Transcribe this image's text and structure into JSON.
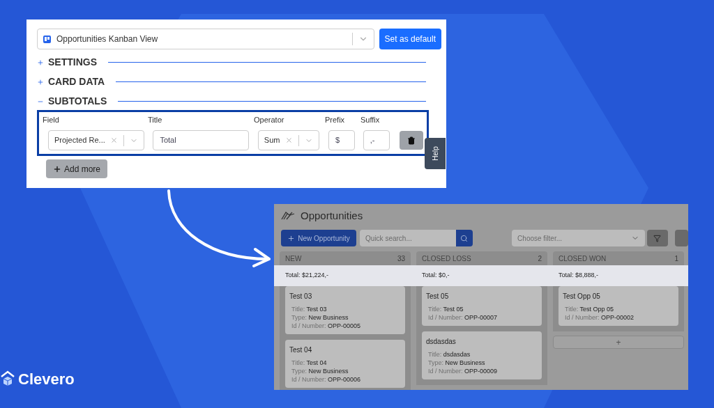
{
  "config_panel": {
    "view_select": {
      "value": "Opportunities Kanban View"
    },
    "default_button": "Set as default",
    "sections": [
      {
        "title": "SETTINGS",
        "expanded": false
      },
      {
        "title": "CARD DATA",
        "expanded": false
      },
      {
        "title": "SUBTOTALS",
        "expanded": true
      }
    ],
    "subtotal_columns": [
      "Field",
      "Title",
      "Operator",
      "Prefix",
      "Suffix"
    ],
    "subtotal_row": {
      "field": "Projected Re...",
      "title": "Total",
      "operator": "Sum",
      "prefix": "$",
      "suffix": ",-"
    },
    "add_button": "Add more",
    "help_tab": "Help"
  },
  "kanban": {
    "title": "Opportunities",
    "new_button": "New Opportunity",
    "search": {
      "placeholder": "Quick search..."
    },
    "filter": {
      "placeholder": "Choose filter..."
    },
    "columns": [
      {
        "name": "NEW",
        "count": "33",
        "total": "Total: $21,224,-",
        "cards": [
          {
            "heading": "Test 03",
            "fields": [
              {
                "label": "Title:",
                "value": "Test 03"
              },
              {
                "label": "Type:",
                "value": "New Business"
              },
              {
                "label": "Id / Number:",
                "value": "OPP-00005"
              }
            ]
          },
          {
            "heading": "Test 04",
            "fields": [
              {
                "label": "Title:",
                "value": "Test 04"
              },
              {
                "label": "Type:",
                "value": "New Business"
              },
              {
                "label": "Id / Number:",
                "value": "OPP-00006"
              }
            ]
          }
        ]
      },
      {
        "name": "CLOSED LOSS",
        "count": "2",
        "total": "Total: $0,-",
        "cards": [
          {
            "heading": "Test 05",
            "fields": [
              {
                "label": "Title:",
                "value": "Test 05"
              },
              {
                "label": "Id / Number:",
                "value": "OPP-00007"
              }
            ]
          },
          {
            "heading": "dsdasdas",
            "fields": [
              {
                "label": "Title:",
                "value": "dsdasdas"
              },
              {
                "label": "Type:",
                "value": "New Business"
              },
              {
                "label": "Id / Number:",
                "value": "OPP-00009"
              }
            ]
          }
        ]
      },
      {
        "name": "CLOSED WON",
        "count": "1",
        "total": "Total: $8,888,-",
        "add_button": "+",
        "cards": [
          {
            "heading": "Test Opp 05",
            "fields": [
              {
                "label": "Title:",
                "value": "Test Opp 05"
              },
              {
                "label": "Id / Number:",
                "value": "OPP-00002"
              }
            ]
          }
        ]
      }
    ]
  },
  "brand": "Clevero"
}
